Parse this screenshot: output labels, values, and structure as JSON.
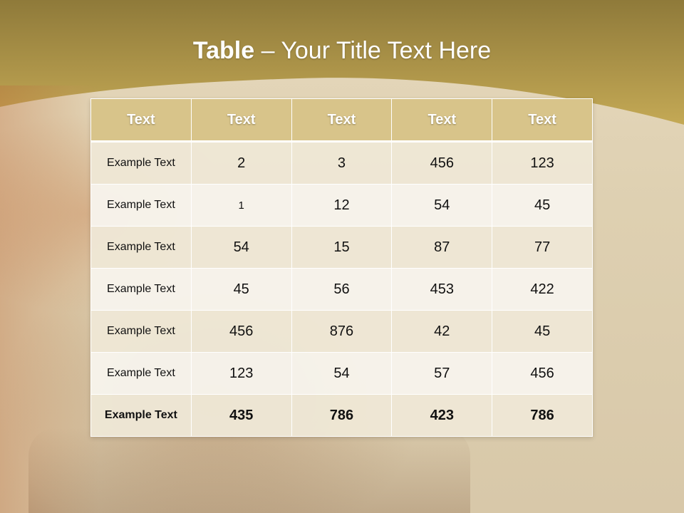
{
  "slide": {
    "title_bold": "Table",
    "title_rest": " – Your Title Text Here"
  },
  "table": {
    "headers": [
      "Text",
      "Text",
      "Text",
      "Text",
      "Text"
    ],
    "rows": [
      [
        "Example Text",
        "2",
        "3",
        "456",
        "123"
      ],
      [
        "Example Text",
        "1",
        "12",
        "54",
        "45"
      ],
      [
        "Example Text",
        "54",
        "15",
        "87",
        "77"
      ],
      [
        "Example Text",
        "45",
        "56",
        "453",
        "422"
      ],
      [
        "Example Text",
        "456",
        "876",
        "42",
        "45"
      ],
      [
        "Example Text",
        "123",
        "54",
        "57",
        "456"
      ],
      [
        "Example Text",
        "435",
        "786",
        "423",
        "786"
      ]
    ]
  },
  "colors": {
    "header_band": "#a68c3f",
    "table_header": "#d8c48a",
    "title_text": "#ffffff"
  }
}
